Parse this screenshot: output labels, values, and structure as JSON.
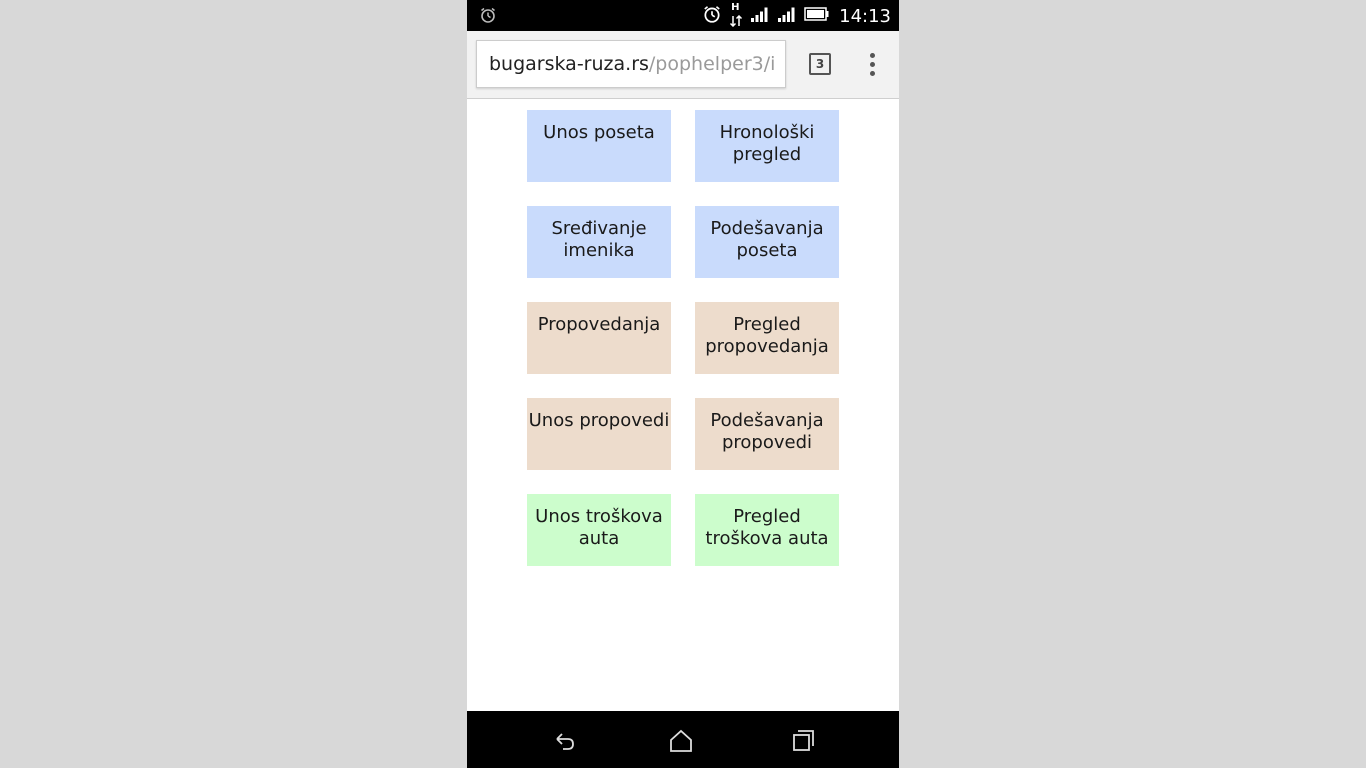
{
  "status_bar": {
    "time": "14:13",
    "network_label": "H",
    "icons": [
      "alarm-icon",
      "signal-icon",
      "battery-icon"
    ]
  },
  "browser": {
    "url_host": "bugarska-ruza.rs",
    "url_path": "/pophelper3/i",
    "tab_count": "3"
  },
  "menu": {
    "buttons": [
      {
        "label": "Unos poseta",
        "color": "#c9dbfc"
      },
      {
        "label": "Hronološki pregled",
        "color": "#c9dbfc"
      },
      {
        "label": "Sređivanje imenika",
        "color": "#c9dbfc"
      },
      {
        "label": "Podešavanja poseta",
        "color": "#c9dbfc"
      },
      {
        "label": "Propovedanja",
        "color": "#eddccc"
      },
      {
        "label": "Pregled propovedanja",
        "color": "#eddccc"
      },
      {
        "label": "Unos propovedi",
        "color": "#eddccc"
      },
      {
        "label": "Podešavanja propovedi",
        "color": "#eddccc"
      },
      {
        "label": "Unos troškova auta",
        "color": "#ccfdcc"
      },
      {
        "label": "Pregled troškova auta",
        "color": "#ccfdcc"
      }
    ]
  },
  "nav": {
    "icons": [
      "back-icon",
      "home-icon",
      "recents-icon"
    ]
  }
}
